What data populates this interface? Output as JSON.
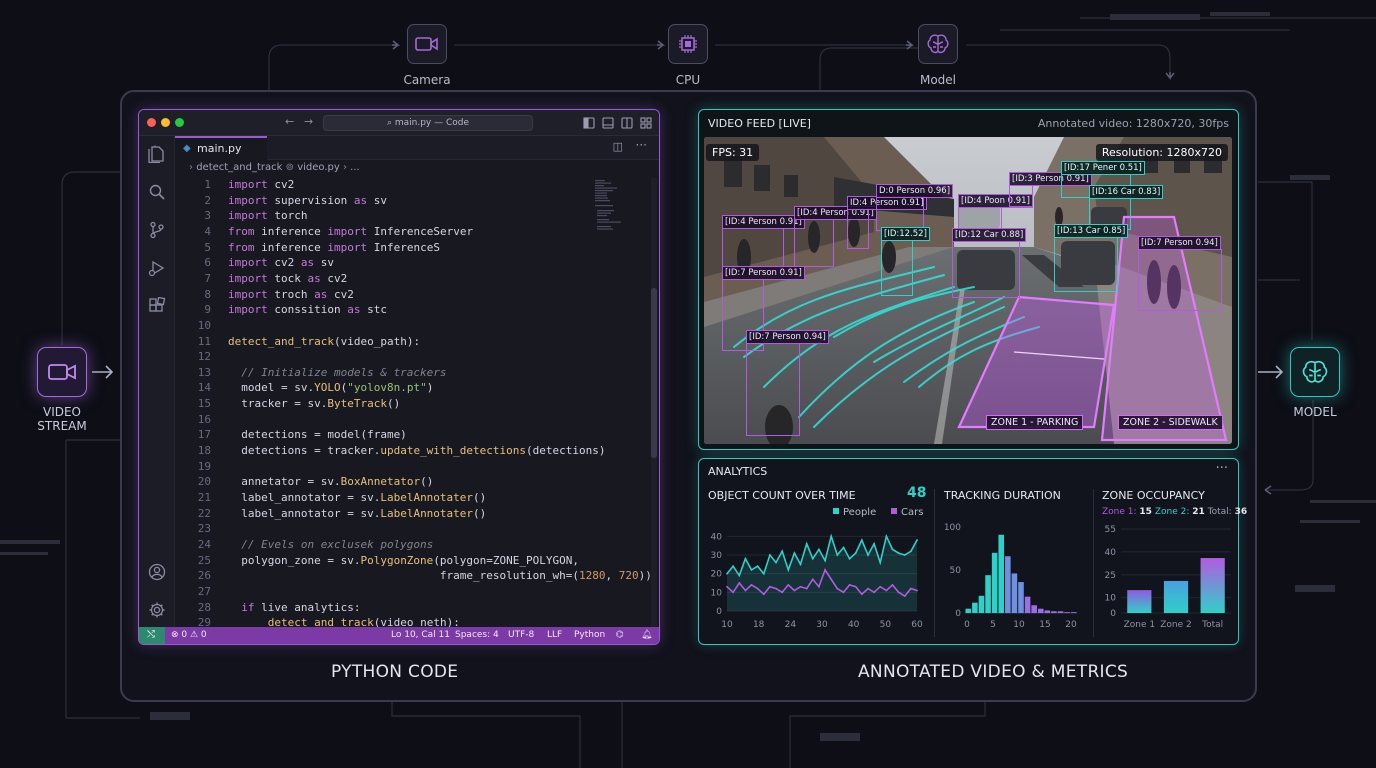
{
  "pipeline": {
    "nodes": [
      {
        "label": "Camera",
        "icon": "camera-icon"
      },
      {
        "label": "CPU",
        "icon": "cpu-icon"
      },
      {
        "label": "Model",
        "icon": "brain-icon"
      }
    ],
    "video_stream": {
      "label": "VIDEO\nSTREAM",
      "icon": "camera-icon"
    },
    "model_out": {
      "label": "MODEL",
      "icon": "brain-icon"
    }
  },
  "editor": {
    "title": "main.py — Code",
    "tab": "main.py",
    "breadcrumb": [
      "detect_and_track",
      "video.py",
      "..."
    ],
    "lines": [
      {
        "n": "1",
        "code": "import cv2"
      },
      {
        "n": "2",
        "code": "import supervision as sv"
      },
      {
        "n": "3",
        "code": "import torch"
      },
      {
        "n": "4",
        "code": "from inference import InferenceServer"
      },
      {
        "n": "5",
        "code": "from inference import InferenceS"
      },
      {
        "n": "6",
        "code": "import cv2 as sv"
      },
      {
        "n": "7",
        "code": "import tock as cv2"
      },
      {
        "n": "8",
        "code": "import troch as cv2"
      },
      {
        "n": "9",
        "code": "import conssition as stc"
      },
      {
        "n": "10",
        "code": ""
      },
      {
        "n": "11",
        "code": "detect_and_track(video_path):"
      },
      {
        "n": "12",
        "code": ""
      },
      {
        "n": "13",
        "code": "  // Initialize models & trackers"
      },
      {
        "n": "14",
        "code": "  model = sv.YOLO(\"yolov8n.pt\")"
      },
      {
        "n": "15",
        "code": "  tracker = sv.ByteTrack()"
      },
      {
        "n": "16",
        "code": ""
      },
      {
        "n": "17",
        "code": "  detections = model(frame)"
      },
      {
        "n": "18",
        "code": "  detections = tracker.update_with_detections(detections)"
      },
      {
        "n": "19",
        "code": ""
      },
      {
        "n": "20",
        "code": "  annetator = sv.BoxAnnetator()"
      },
      {
        "n": "21",
        "code": "  label_annotator = sv.LabelAnnotater()"
      },
      {
        "n": "22",
        "code": "  label_annotator = sv.LabelAnnotater()"
      },
      {
        "n": "23",
        "code": ""
      },
      {
        "n": "24",
        "code": "  // Evels on exclusek polygons"
      },
      {
        "n": "25",
        "code": "  polygon_zone = sv.PolygonZone(polygon=ZONE_POLYGON,"
      },
      {
        "n": "26",
        "code": "                                frame_resolution_wh=(1280, 720))"
      },
      {
        "n": "27",
        "code": ""
      },
      {
        "n": "28",
        "code": "  if live analytics:"
      },
      {
        "n": "29",
        "code": "      detect_and_track(video_neth):"
      }
    ],
    "status": {
      "problems": "⊗ 0 ⚠ 0",
      "position": "Lo 10, Cal 11",
      "spaces": "Spaces: 4",
      "encoding": "UTF-8",
      "eol": "LLF",
      "language": "Python"
    }
  },
  "video": {
    "title": "VIDEO FEED [LIVE]",
    "meta": "Annotated video: 1280x720, 30fps",
    "fps": "FPS: 31",
    "resolution": "Resolution: 1280x720",
    "detections": [
      {
        "label": "[ID:4 Person 0.91]",
        "kind": "person"
      },
      {
        "label": "[ID:4 Person 0.91]",
        "kind": "person"
      },
      {
        "label": "ID:4 Person 0.91]",
        "kind": "person"
      },
      {
        "label": "D:0 Person 0.96]",
        "kind": "person"
      },
      {
        "label": "[ID:12.52]",
        "kind": "car"
      },
      {
        "label": "[ID:4 Poon 0.91]",
        "kind": "person"
      },
      {
        "label": "[ID:3 Person 0.91]",
        "kind": "person"
      },
      {
        "label": "[ID:17 Pener 0.51]",
        "kind": "car"
      },
      {
        "label": "[ID:16 Car 0.83]",
        "kind": "car"
      },
      {
        "label": "[ID:12 Car 0.88]",
        "kind": "person"
      },
      {
        "label": "[ID:13 Car 0.85]",
        "kind": "car"
      },
      {
        "label": "[ID:7 Person 0.94]",
        "kind": "person"
      },
      {
        "label": "[ID:7 Person 0.91]",
        "kind": "person"
      },
      {
        "label": "[ID:7 Person 0.94]",
        "kind": "person"
      }
    ],
    "zones": [
      "ZONE 1 - PARKING",
      "ZONE 2 - SIDEWALK"
    ]
  },
  "analytics": {
    "title": "ANALYTICS",
    "more": "···",
    "object_count": {
      "title": "OBJECT COUNT OVER TIME",
      "value": "48"
    },
    "tracking": {
      "title": "TRACKING DURATION"
    },
    "zone": {
      "title": "ZONE OCCUPANCY",
      "z1_label": "Zone 1:",
      "z1": "15",
      "z2_label": "Zone 2:",
      "z2": "21",
      "total_label": "Total:",
      "total": "36"
    }
  },
  "chart_data": [
    {
      "type": "area",
      "title": "OBJECT COUNT OVER TIME",
      "x_ticks": [
        "10",
        "18",
        "24",
        "30",
        "40",
        "50",
        "60"
      ],
      "y_ticks": [
        "0",
        "10",
        "20",
        "30",
        "40"
      ],
      "ylim": [
        0,
        45
      ],
      "series": [
        {
          "name": "People",
          "color": "#2fd0c8",
          "values": [
            20,
            24,
            19,
            28,
            22,
            24,
            20,
            30,
            26,
            32,
            22,
            31,
            25,
            36,
            28,
            33,
            27,
            40,
            30,
            34,
            28,
            31,
            38,
            30,
            36,
            26,
            40,
            33,
            31,
            30,
            32,
            38
          ]
        },
        {
          "name": "Cars",
          "color": "#b25be0",
          "values": [
            13,
            10,
            15,
            11,
            14,
            12,
            9,
            13,
            12,
            10,
            14,
            11,
            13,
            12,
            17,
            13,
            22,
            17,
            12,
            10,
            14,
            13,
            9,
            12,
            10,
            13,
            11,
            14,
            10,
            8,
            12,
            11
          ]
        }
      ]
    },
    {
      "type": "bar",
      "title": "TRACKING DURATION",
      "x_ticks": [
        "0",
        "5",
        "10",
        "15",
        "20"
      ],
      "y_ticks": [
        "0",
        "50",
        "100"
      ],
      "ylim": [
        0,
        100
      ],
      "values": [
        5,
        12,
        20,
        44,
        70,
        91,
        66,
        46,
        36,
        19,
        9,
        5,
        3,
        2,
        2,
        1,
        1
      ]
    },
    {
      "type": "bar",
      "title": "ZONE OCCUPANCY",
      "categories": [
        "Zone 1",
        "Zone 2",
        "Total"
      ],
      "values": [
        15,
        21,
        36
      ],
      "y_ticks": [
        "0",
        "10",
        "25",
        "40",
        "55"
      ],
      "ylim": [
        0,
        55
      ]
    }
  ],
  "labels": {
    "left": "PYTHON CODE",
    "right": "ANNOTATED VIDEO & METRICS"
  },
  "colors": {
    "accent_purple": "#b25be0",
    "accent_cyan": "#2fd0c8",
    "background": "#0d0e16"
  }
}
